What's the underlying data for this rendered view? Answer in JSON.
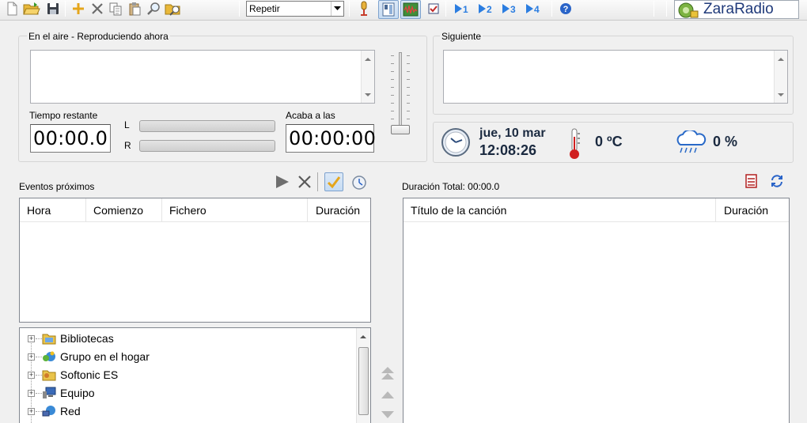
{
  "toolbar": {
    "buttons": [
      {
        "name": "new-file-icon"
      },
      {
        "name": "open-folder-icon"
      },
      {
        "name": "save-icon"
      },
      {
        "name": "add-icon"
      },
      {
        "name": "delete-icon"
      },
      {
        "name": "copy-icon"
      },
      {
        "name": "paste-icon"
      },
      {
        "name": "find-icon"
      },
      {
        "name": "open-file-icon"
      }
    ],
    "mode_select": {
      "value": "Repetir"
    },
    "view_buttons": [
      {
        "name": "microphone-icon"
      },
      {
        "name": "layout-icon"
      },
      {
        "name": "wave-icon"
      },
      {
        "name": "checklist-icon"
      }
    ],
    "player_buttons": [
      {
        "label": "1"
      },
      {
        "label": "2"
      },
      {
        "label": "3"
      },
      {
        "label": "4"
      }
    ],
    "help_icon": "help-icon",
    "brand": "ZaraRadio"
  },
  "on_air": {
    "title": "En el aire - Reproduciendo ahora",
    "remaining_label": "Tiempo restante",
    "remaining_value": "00:00.0",
    "ends_label": "Acaba a las",
    "ends_value": "00:00:00",
    "meter_left_label": "L",
    "meter_right_label": "R"
  },
  "next": {
    "title": "Siguiente"
  },
  "status": {
    "date": "jue, 10 mar",
    "time": "12:08:26",
    "temperature": "0 ºC",
    "rain": "0 %"
  },
  "events": {
    "title": "Eventos próximos",
    "columns": [
      "Hora",
      "Comienzo",
      "Fichero",
      "Duración"
    ]
  },
  "playlist": {
    "total_label": "Duración Total: 00:00.0",
    "columns": [
      "Título de la canción",
      "Duración"
    ]
  },
  "tree": {
    "items": [
      {
        "label": "Bibliotecas",
        "icon": "library-icon"
      },
      {
        "label": "Grupo en el hogar",
        "icon": "homegroup-icon"
      },
      {
        "label": "Softonic ES",
        "icon": "user-folder-icon"
      },
      {
        "label": "Equipo",
        "icon": "computer-icon"
      },
      {
        "label": "Red",
        "icon": "network-icon"
      }
    ]
  },
  "colors": {
    "accent": "#1f6fd0",
    "brand_text": "#1f3a7a",
    "thermometer": "#d02020"
  }
}
